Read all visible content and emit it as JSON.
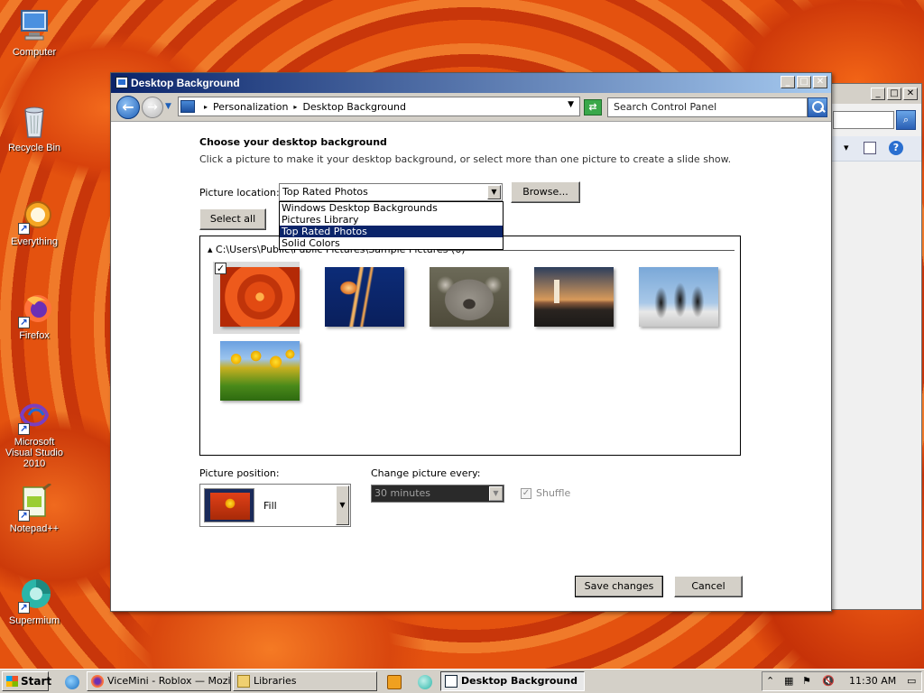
{
  "desktop": {
    "icons": [
      {
        "label": "Computer",
        "icon": "computer-icon"
      },
      {
        "label": "Recycle Bin",
        "icon": "recycle-bin-icon"
      },
      {
        "label": "Everything",
        "icon": "everything-icon"
      },
      {
        "label": "Firefox",
        "icon": "firefox-icon"
      },
      {
        "label": "Microsoft Visual Studio 2010",
        "icon": "visual-studio-icon"
      },
      {
        "label": "Notepad++",
        "icon": "notepad-plus-plus-icon"
      },
      {
        "label": "Supermium",
        "icon": "supermium-icon"
      }
    ]
  },
  "window": {
    "title": "Desktop Background",
    "controls": {
      "minimize": "_",
      "maximize": "□",
      "close": "✕"
    },
    "breadcrumb": [
      "Personalization",
      "Desktop Background"
    ],
    "search_placeholder": "Search Control Panel"
  },
  "content": {
    "heading": "Choose your desktop background",
    "subtitle": "Click a picture to make it your desktop background, or select more than one picture to create a slide show.",
    "picture_location_label": "Picture location:",
    "picture_location_value": "Top Rated Photos",
    "browse_label": "Browse...",
    "select_all_label": "Select all",
    "dropdown_options": [
      "Windows Desktop Backgrounds",
      "Pictures Library",
      "Top Rated Photos",
      "Solid Colors"
    ],
    "selected_option_index": 2,
    "group_header": "C:\\Users\\Public\\Public Pictures\\Sample Pictures (6)",
    "thumbnails": [
      {
        "name": "chrysanthemum",
        "checked": true
      },
      {
        "name": "jellyfish",
        "checked": false
      },
      {
        "name": "koala",
        "checked": false
      },
      {
        "name": "lighthouse",
        "checked": false
      },
      {
        "name": "penguins",
        "checked": false
      },
      {
        "name": "tulips",
        "checked": false
      }
    ],
    "picture_position_label": "Picture position:",
    "picture_position_value": "Fill",
    "change_every_label": "Change picture every:",
    "change_every_value": "30 minutes",
    "shuffle_label": "Shuffle",
    "shuffle_checked": true,
    "save_label": "Save changes",
    "cancel_label": "Cancel"
  },
  "taskbar": {
    "start_label": "Start",
    "tasks": [
      {
        "label": "ViceMini - Roblox — Mozil...",
        "active": false
      },
      {
        "label": "Libraries",
        "active": false
      },
      {
        "label": "Desktop Background",
        "active": true
      }
    ],
    "clock": "11:30 AM"
  },
  "colors": {
    "titlebar_start": "#0a246a",
    "titlebar_end": "#a6caf0",
    "selection": "#0a246a",
    "chrome": "#d4d0c8"
  }
}
